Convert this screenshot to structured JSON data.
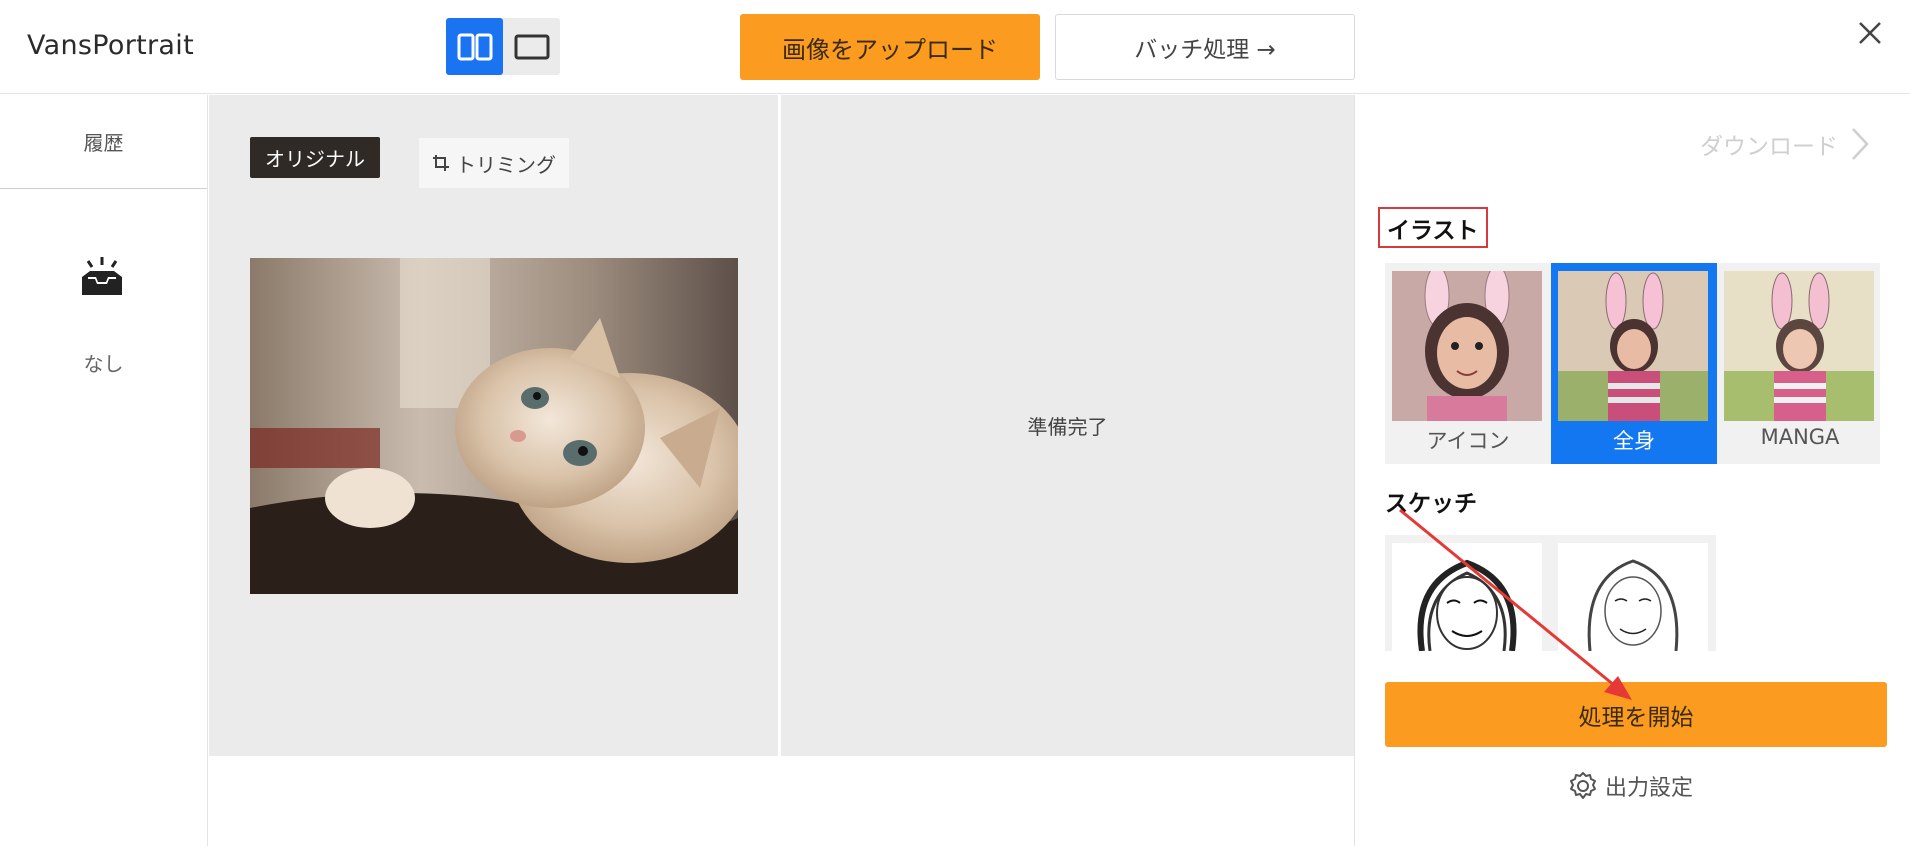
{
  "header": {
    "app_name": "VansPortrait",
    "upload_label": "画像をアップロード",
    "batch_label": "バッチ処理 →"
  },
  "sidebar": {
    "history_tab": "履歴",
    "empty_label": "なし"
  },
  "canvas": {
    "original_tag": "オリジナル",
    "trim_label": "トリミング",
    "ready_text": "準備完了"
  },
  "panel": {
    "download_label": "ダウンロード",
    "illustration_title": "イラスト",
    "styles": [
      {
        "label": "アイコン",
        "selected": false
      },
      {
        "label": "全身",
        "selected": true
      },
      {
        "label": "MANGA",
        "selected": false
      }
    ],
    "sketch_title": "スケッチ",
    "start_label": "処理を開始",
    "output_settings_label": "出力設定"
  },
  "colors": {
    "accent_orange": "#fb9b20",
    "selected_blue": "#1477f2",
    "annotation_red": "#e53935"
  }
}
